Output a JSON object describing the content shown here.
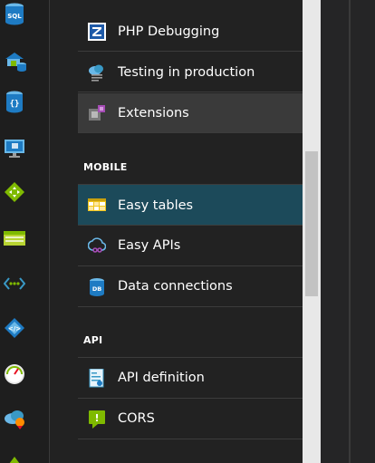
{
  "colors": {
    "rail_bg": "#1e1e1e",
    "blade_bg": "#222222",
    "selected_bg": "#1c4a5a",
    "hover_bg": "#3a3a3a",
    "text": "#ffffff",
    "accent_blue": "#3999c6",
    "accent_green": "#7fba00"
  },
  "rail": {
    "icons": [
      {
        "name": "sql-database-icon",
        "label": "SQL"
      },
      {
        "name": "app-service-environment-icon"
      },
      {
        "name": "cosmos-db-icon"
      },
      {
        "name": "virtual-machine-icon"
      },
      {
        "name": "api-management-icon"
      },
      {
        "name": "storage-table-icon"
      },
      {
        "name": "connections-icon"
      },
      {
        "name": "logic-app-icon"
      },
      {
        "name": "monitor-gauge-icon"
      },
      {
        "name": "cloud-badge-icon"
      },
      {
        "name": "partial-green-icon"
      }
    ]
  },
  "blade": {
    "items_top": [
      {
        "label": "PHP Debugging",
        "icon": "php-debugging-icon"
      },
      {
        "label": "Testing in production",
        "icon": "testing-in-production-icon"
      },
      {
        "label": "Extensions",
        "icon": "extensions-icon",
        "state": "hovered"
      }
    ],
    "section_mobile": {
      "title": "MOBILE",
      "items": [
        {
          "label": "Easy tables",
          "icon": "easy-tables-icon",
          "state": "selected"
        },
        {
          "label": "Easy APIs",
          "icon": "easy-apis-icon"
        },
        {
          "label": "Data connections",
          "icon": "data-connections-icon",
          "badge": "DB"
        }
      ]
    },
    "section_api": {
      "title": "API",
      "items": [
        {
          "label": "API definition",
          "icon": "api-definition-icon"
        },
        {
          "label": "CORS",
          "icon": "cors-icon",
          "glyph": "!"
        }
      ]
    }
  }
}
